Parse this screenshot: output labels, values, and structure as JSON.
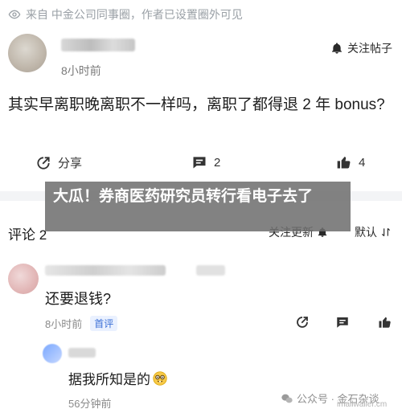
{
  "notice": {
    "text": "来自 中金公司同事圈，作者已设置圈外可见",
    "icon": "eye-icon"
  },
  "post": {
    "author_name": "",
    "time": "8小时前",
    "follow_label": "关注帖子",
    "body": "其实早离职晚离职不一样吗，离职了都得退 2 年 bonus?",
    "share_label": "分享",
    "comment_count": "2",
    "like_count": "4"
  },
  "banner": {
    "text": "大瓜！券商医药研究员转行看电子去了"
  },
  "comments_header": {
    "title": "评论 2",
    "sort_label": "关注更新",
    "order_label": "默认"
  },
  "comments": [
    {
      "text": "还要退钱?",
      "time": "8小时前",
      "badge": "首评",
      "replies": [
        {
          "text": "据我所知是的",
          "time": "56分钟前",
          "emoji": "nerd-face"
        }
      ]
    }
  ],
  "watermark": {
    "text": "公众号 · 金石杂谈",
    "sub": "imailwaller.cm"
  },
  "colors": {
    "accent": "#3b6fd6",
    "muted": "#8a8a8a",
    "banner_bg": "#6e6e6e"
  }
}
